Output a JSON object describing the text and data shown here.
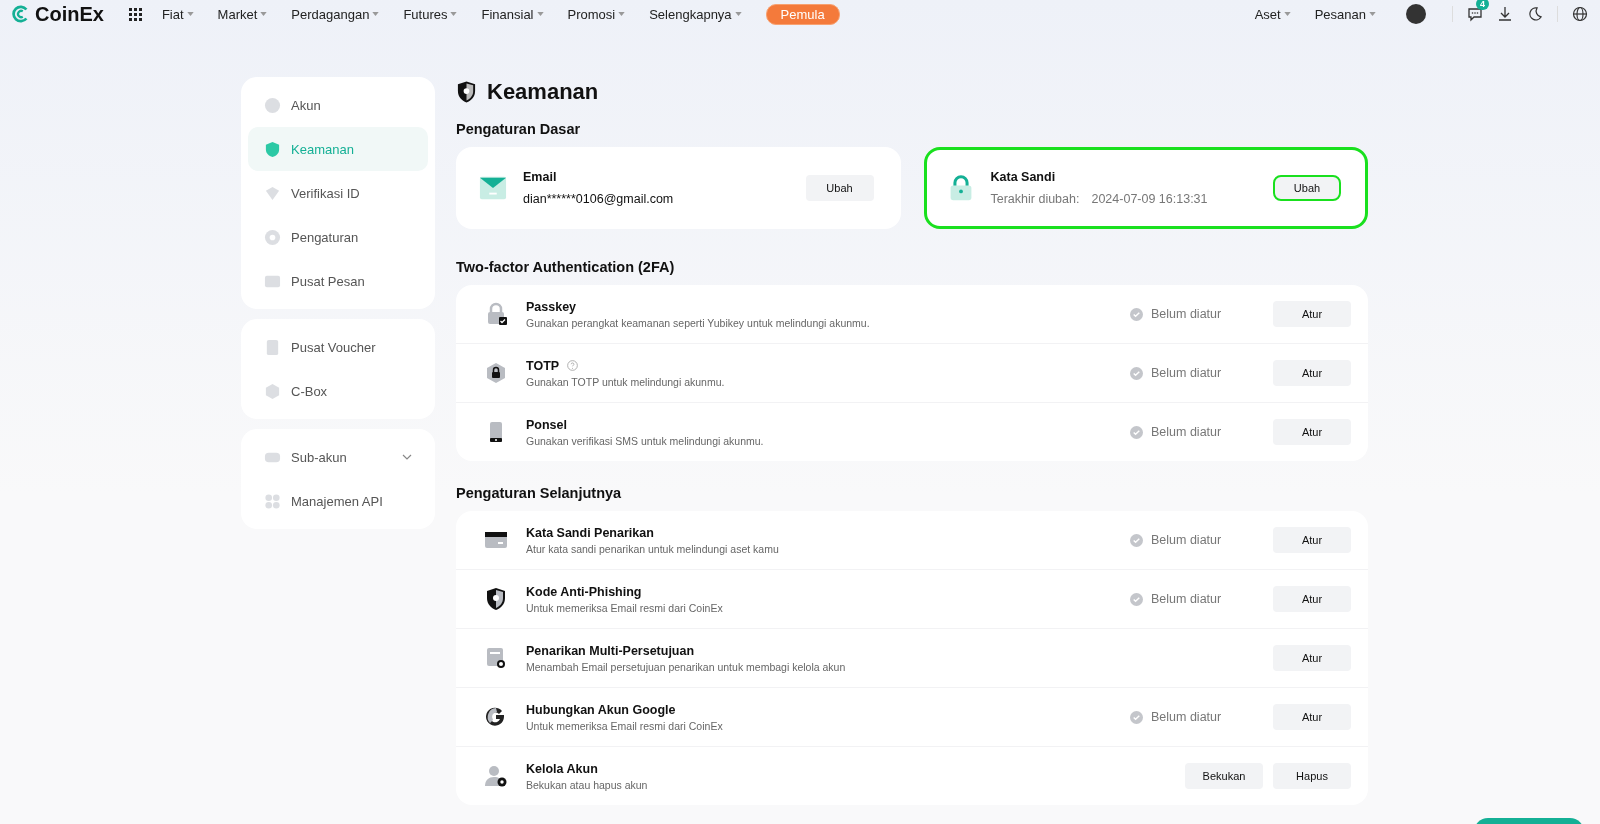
{
  "nav": {
    "logo": "CoinEx",
    "items": [
      {
        "label": "Fiat",
        "kind": "menu"
      },
      {
        "label": "Market",
        "kind": "menu"
      },
      {
        "label": "Perdagangan",
        "kind": "menu"
      },
      {
        "label": "Futures",
        "kind": "menu"
      },
      {
        "label": "Finansial",
        "kind": "menu"
      },
      {
        "label": "Promosi",
        "kind": "menu"
      },
      {
        "label": "Selengkapnya",
        "kind": "menu"
      },
      {
        "label": "Pemula",
        "kind": "pill"
      }
    ],
    "right_items": [
      {
        "label": "Aset"
      },
      {
        "label": "Pesanan"
      }
    ],
    "message_badge": "4"
  },
  "sidebar": {
    "groups": [
      {
        "items": [
          {
            "label": "Akun",
            "kind": "account",
            "selected": false
          },
          {
            "label": "Keamanan",
            "kind": "security",
            "selected": true
          },
          {
            "label": "Verifikasi ID",
            "kind": "verify",
            "selected": false
          },
          {
            "label": "Pengaturan",
            "kind": "settings",
            "selected": false
          },
          {
            "label": "Pusat Pesan",
            "kind": "message",
            "selected": false
          }
        ]
      },
      {
        "items": [
          {
            "label": "Pusat Voucher",
            "kind": "voucher",
            "selected": false
          },
          {
            "label": "C-Box",
            "kind": "box",
            "selected": false
          }
        ]
      },
      {
        "items": [
          {
            "label": "Sub-akun",
            "kind": "subaccount",
            "selected": false,
            "expanded": false
          },
          {
            "label": "Manajemen API",
            "kind": "api",
            "selected": false
          }
        ]
      }
    ]
  },
  "page": {
    "title": "Keamanan",
    "basic": {
      "heading": "Pengaturan Dasar",
      "cards": [
        {
          "kind": "email",
          "title": "Email",
          "value": "dian******0106@gmail.com",
          "button": "Ubah",
          "highlighted": false
        },
        {
          "kind": "password",
          "title": "Kata Sandi",
          "label": "Terakhir diubah:",
          "value": "2024-07-09 16:13:31",
          "button": "Ubah",
          "highlighted": true
        }
      ]
    },
    "twofa": {
      "heading": "Two-factor Authentication (2FA)",
      "rows": [
        {
          "kind": "passkey",
          "title": "Passkey",
          "help": false,
          "desc": "Gunakan perangkat keamanan seperti Yubikey untuk melindungi akunmu.",
          "status": "Belum diatur",
          "buttons": [
            "Atur"
          ]
        },
        {
          "kind": "totp",
          "title": "TOTP",
          "help": true,
          "desc": "Gunakan TOTP untuk melindungi akunmu.",
          "status": "Belum diatur",
          "buttons": [
            "Atur"
          ]
        },
        {
          "kind": "phone",
          "title": "Ponsel",
          "help": false,
          "desc": "Gunakan verifikasi SMS untuk melindungi akunmu.",
          "status": "Belum diatur",
          "buttons": [
            "Atur"
          ]
        }
      ]
    },
    "advanced": {
      "heading": "Pengaturan Selanjutnya",
      "rows": [
        {
          "kind": "card",
          "title": "Kata Sandi Penarikan",
          "help": false,
          "desc": "Atur kata sandi penarikan untuk melindungi aset kamu",
          "status": "Belum diatur",
          "buttons": [
            "Atur"
          ]
        },
        {
          "kind": "shield",
          "title": "Kode Anti-Phishing",
          "help": false,
          "desc": "Untuk memeriksa Email resmi dari CoinEx",
          "status": "Belum diatur",
          "buttons": [
            "Atur"
          ]
        },
        {
          "kind": "approval",
          "title": "Penarikan Multi-Persetujuan",
          "help": false,
          "desc": "Menambah Email persetujuan penarikan untuk membagi kelola akun",
          "buttons": [
            "Atur"
          ]
        },
        {
          "kind": "google",
          "title": "Hubungkan Akun Google",
          "help": false,
          "desc": "Untuk memeriksa Email resmi dari CoinEx",
          "status": "Belum diatur",
          "buttons": [
            "Atur"
          ]
        },
        {
          "kind": "user",
          "title": "Kelola Akun",
          "help": false,
          "desc": "Bekukan atau hapus akun",
          "buttons": [
            "Bekukan",
            "Hapus"
          ]
        }
      ]
    }
  }
}
